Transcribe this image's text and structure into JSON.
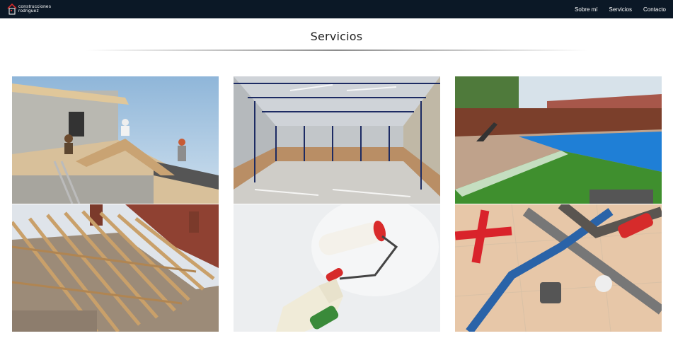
{
  "header": {
    "brand_line1": "construcciones",
    "brand_line2": "rodriguez",
    "nav": [
      {
        "label": "Sobre mí"
      },
      {
        "label": "Servicios"
      },
      {
        "label": "Contacto"
      }
    ]
  },
  "main": {
    "title": "Servicios"
  },
  "colors": {
    "navbar": "#0b1826",
    "accent_red": "#d62b2b",
    "text": "#222222"
  }
}
